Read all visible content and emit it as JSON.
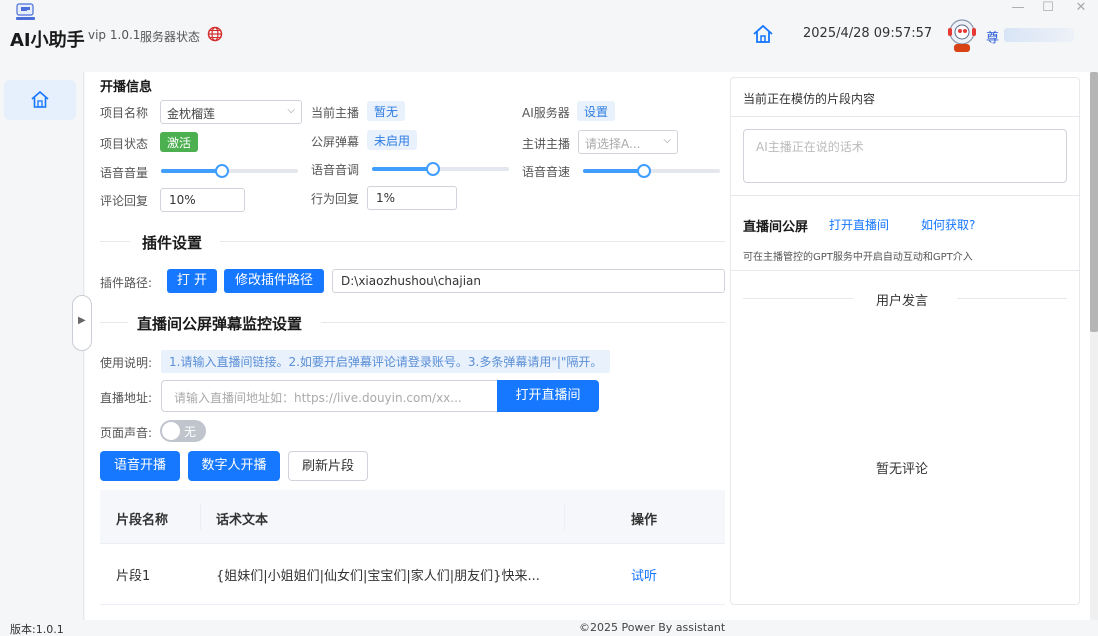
{
  "app": {
    "title": "AI小助手",
    "version": "vip 1.0.1",
    "server_status_label": "服务器状态",
    "datetime": "2025/4/28 09:57:57",
    "username": "尊"
  },
  "live_info": {
    "section_title": "开播信息",
    "project_name_label": "项目名称",
    "project_name_value": "金枕榴莲",
    "current_host_label": "当前主播",
    "current_host_value": "暂无",
    "ai_server_label": "AI服务器",
    "ai_server_value": "设置",
    "project_status_label": "项目状态",
    "project_status_value": "激活",
    "public_danmaku_label": "公屏弹幕",
    "public_danmaku_value": "未启用",
    "main_host_label": "主讲主播",
    "main_host_placeholder": "请选择A...",
    "voice_volume_label": "语音音量",
    "voice_volume_level": 0.45,
    "voice_pitch_label": "语音音调",
    "voice_pitch_level": 0.45,
    "voice_speed_label": "语音音速",
    "voice_speed_level": 0.45,
    "comment_reply_label": "评论回复",
    "comment_reply_value": "10%",
    "action_reply_label": "行为回复",
    "action_reply_value": "1%"
  },
  "plugin": {
    "section_title": "插件设置",
    "path_label": "插件路径:",
    "open_btn": "打 开",
    "modify_btn": "修改插件路径",
    "path_value": "D:\\xiaozhushou\\chajian"
  },
  "monitor": {
    "section_title": "直播间公屏弹幕监控设置",
    "usage_label": "使用说明:",
    "usage_text": "1.请输入直播间链接。2.如要开启弹幕评论请登录账号。3.多条弹幕请用\"|\"隔开。",
    "address_label": "直播地址:",
    "address_placeholder": "请输入直播间地址如：https://live.douyin.com/xx...",
    "open_live_btn": "打开直播间",
    "sound_label": "页面声音:",
    "sound_toggle": "无"
  },
  "actions": {
    "voice_start": "语音开播",
    "digital_start": "数字人开播",
    "refresh": "刷新片段"
  },
  "table": {
    "headers": [
      "片段名称",
      "话术文本",
      "操作"
    ],
    "rows": [
      {
        "name": "片段1",
        "text": "{姐妹们|小姐姐们|仙女们|宝宝们|家人们|朋友们}快来...",
        "action": "试听"
      }
    ]
  },
  "right_panel": {
    "imitating_title": "当前正在模仿的片段内容",
    "ai_placeholder": "AI主播正在说的话术",
    "public_screen_label": "直播间公屏",
    "open_live_link": "打开直播间",
    "how_link": "如何获取?",
    "gpt_note": "可在主播管控的GPT服务中开启自动互动和GPT介入",
    "user_speech_title": "用户发言",
    "no_comments": "暂无评论"
  },
  "footer": {
    "version": "版本:1.0.1",
    "copyright": "©2025 Power By assistant"
  },
  "colors": {
    "primary": "#1677ff",
    "tag_blue_bg": "#e8f1fc",
    "active_green": "#4caf50"
  }
}
